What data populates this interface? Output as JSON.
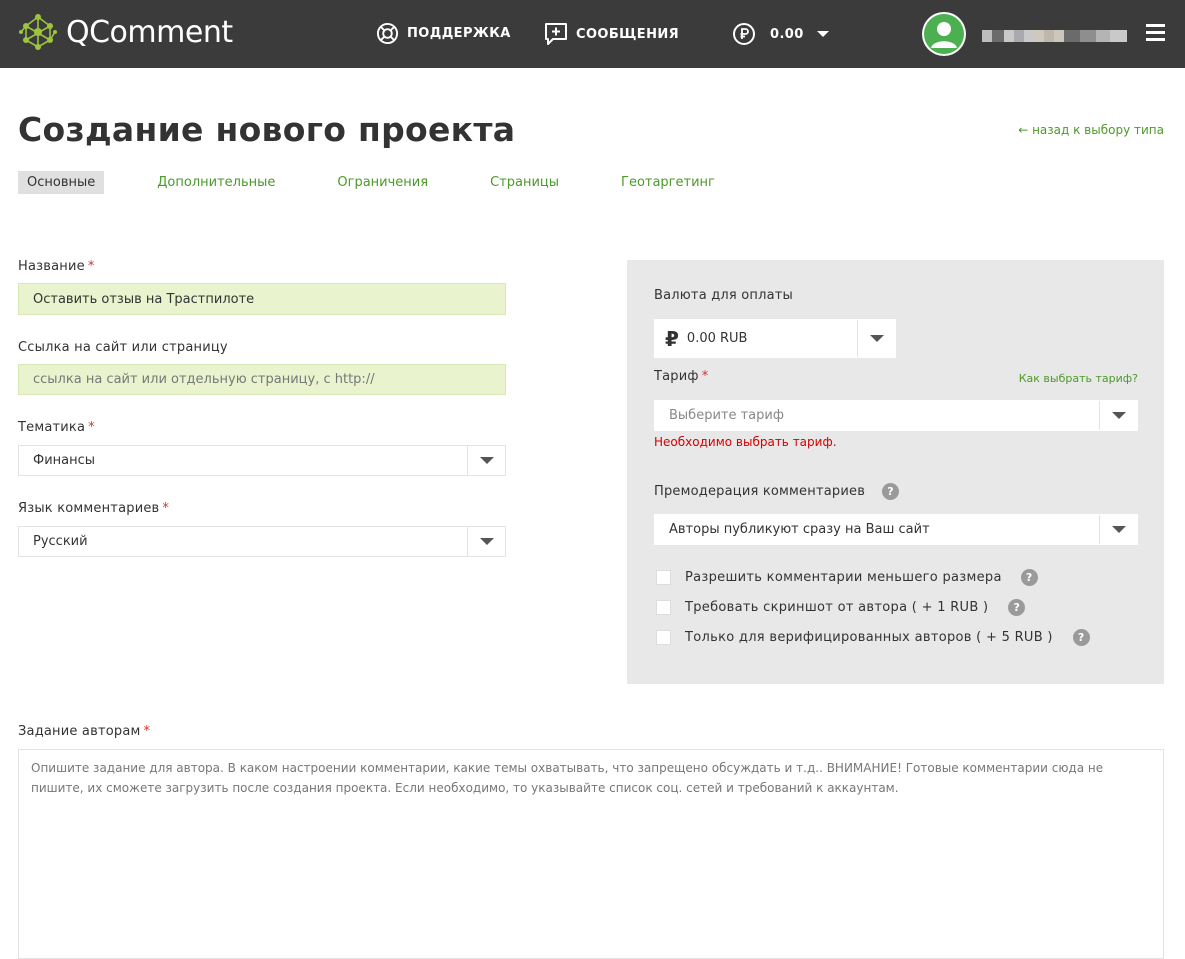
{
  "header": {
    "logo_text": "QComment",
    "support_label": "ПОДДЕРЖКА",
    "messages_label": "СООБЩЕНИЯ",
    "balance": "0.00",
    "accent": "#3b3b3b"
  },
  "page": {
    "title": "Создание нового проекта",
    "back_link": "← назад к выбору типа"
  },
  "tabs": [
    {
      "label": "Основные",
      "active": true
    },
    {
      "label": "Дополнительные"
    },
    {
      "label": "Ограничения"
    },
    {
      "label": "Страницы"
    },
    {
      "label": "Геотаргетинг"
    }
  ],
  "form": {
    "name_label": "Название",
    "name_value": "Оставить отзыв на Трастпилоте",
    "url_label": "Ссылка на сайт или страницу",
    "url_placeholder": "ссылка на сайт или отдельную страницу, с http://",
    "topic_label": "Тематика",
    "topic_value": "Финансы",
    "lang_label": "Язык комментариев",
    "lang_value": "Русский",
    "task_label": "Задание авторам",
    "task_placeholder": "Опишите задание для автора. В каком настроении комментарии, какие темы охватывать, что запрещено обсуждать и т.д.. ВНИМАНИЕ! Готовые комментарии сюда не пишите, их сможете загрузить после создания проекта. Если необходимо, то указывайте список соц. сетей и требований к аккаунтам.",
    "required_mark": "*"
  },
  "panel": {
    "currency_label": "Валюта для оплаты",
    "currency_symbol": "₽",
    "currency_value": "0.00 RUB",
    "tariff_label": "Тариф",
    "tariff_help_link": "Как выбрать тариф?",
    "tariff_placeholder": "Выберите тариф",
    "tariff_error": "Необходимо выбрать тариф.",
    "premod_label": "Премодерация комментариев",
    "premod_value": "Авторы публикуют сразу на Ваш сайт",
    "help_glyph": "?",
    "checkboxes": [
      {
        "label": "Разрешить комментарии меньшего размера",
        "checked": false
      },
      {
        "label": "Требовать скриншот от автора ( + 1 RUB )",
        "checked": false
      },
      {
        "label": "Только для верифицированных авторов ( + 5 RUB )",
        "checked": false
      }
    ]
  }
}
